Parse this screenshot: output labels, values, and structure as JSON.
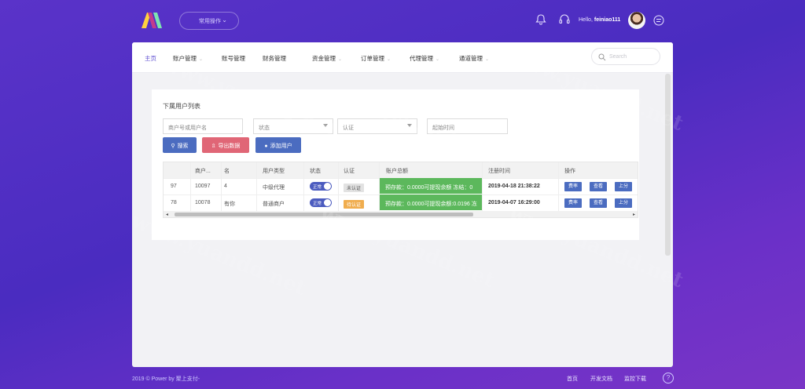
{
  "header": {
    "quick_menu": "常用操作",
    "greeting": "Hello,",
    "username": "feiniao111"
  },
  "nav": {
    "items": [
      {
        "label": "主页",
        "dropdown": false
      },
      {
        "label": "账户管理",
        "dropdown": true
      },
      {
        "label": "账号管理",
        "dropdown": false
      },
      {
        "label": "财务管理",
        "dropdown": false
      },
      {
        "label": "资金管理",
        "dropdown": true
      },
      {
        "label": "订单管理",
        "dropdown": true
      },
      {
        "label": "代理管理",
        "dropdown": true
      },
      {
        "label": "通道管理",
        "dropdown": true
      }
    ],
    "search_placeholder": "Search"
  },
  "page": {
    "title": "下属用户列表",
    "filters": {
      "account_placeholder": "商户号或用户名",
      "status_placeholder": "状态",
      "auth_placeholder": "认证",
      "start_time_placeholder": "起始时间"
    },
    "buttons": {
      "search": "搜索",
      "export": "导出数据",
      "add_user": "添加用户"
    }
  },
  "table": {
    "columns": [
      "",
      "商户...",
      "名",
      "用户类型",
      "状态",
      "认证",
      "账户总额",
      "注册时间",
      "操作"
    ],
    "rows": [
      {
        "id": "97",
        "merchant": "10097",
        "name": "4",
        "type": "中级代理",
        "status": "正常",
        "auth": "未认证",
        "balance": "预存款：0.0000可提现余额 冻结：0",
        "reg_time": "2019-04-18 21:38:22",
        "ops": [
          "费率",
          "查看",
          "上分"
        ]
      },
      {
        "id": "78",
        "merchant": "10078",
        "name": "有你",
        "type": "普通商户",
        "status": "正常",
        "auth": "待认证",
        "balance": "预存款：0.0000可提现余额:0.0196 冻",
        "reg_time": "2019-04-07 16:29:00",
        "ops": [
          "费率",
          "查看",
          "上分"
        ]
      }
    ]
  },
  "footer": {
    "copyright": "2019 © Power by 聚上支付-",
    "links": [
      "首页",
      "开发文档",
      "监控下载"
    ],
    "help": "?"
  },
  "watermark": "www.yuandd.net",
  "colors": {
    "background": "#5a33c9",
    "primary_button": "#4b6cc0",
    "export_button": "#e06676",
    "balance_cell": "#5cb85c",
    "status_toggle": "#4b5bbf"
  }
}
